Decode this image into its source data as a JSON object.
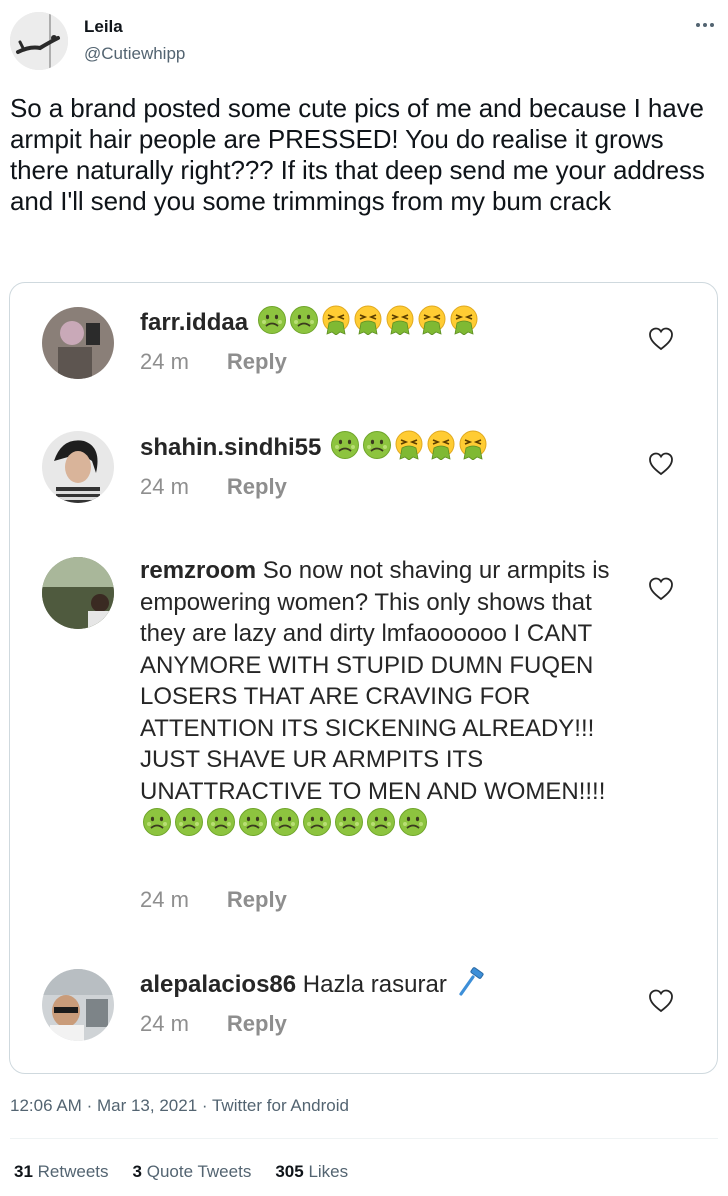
{
  "author": {
    "display_name": "Leila",
    "handle": "@Cutiewhipp"
  },
  "tweet": {
    "text": "So a brand posted some cute pics of me and because I have armpit hair people are PRESSED! You do realise it grows there naturally right??? If its that deep send me your address and I'll send you some trimmings from my bum crack"
  },
  "comments": [
    {
      "username": "farr.iddaa",
      "text": "",
      "emojis": [
        "nauseated-face",
        "nauseated-face",
        "vomiting-face",
        "vomiting-face",
        "vomiting-face",
        "vomiting-face",
        "vomiting-face"
      ],
      "time": "24 m",
      "reply_label": "Reply"
    },
    {
      "username": "shahin.sindhi55",
      "text": "",
      "emojis": [
        "nauseated-face",
        "nauseated-face",
        "vomiting-face",
        "vomiting-face",
        "vomiting-face"
      ],
      "time": "24 m",
      "reply_label": "Reply"
    },
    {
      "username": "remzroom",
      "text": "So now not shaving ur armpits is empowering women? This only shows that they are lazy and dirty lmfaoooooo I CANT ANYMORE WITH STUPID DUMN FUQEN LOSERS THAT ARE CRAVING FOR ATTENTION ITS SICKENING ALREADY!!! JUST SHAVE UR ARMPITS ITS UNATTRACTIVE TO MEN AND WOMEN!!!!",
      "emojis": [
        "nauseated-face",
        "nauseated-face",
        "nauseated-face",
        "nauseated-face",
        "nauseated-face",
        "nauseated-face",
        "nauseated-face",
        "nauseated-face",
        "nauseated-face"
      ],
      "time": "24 m",
      "reply_label": "Reply"
    },
    {
      "username": "alepalacios86",
      "text": "Hazla rasurar",
      "emojis": [
        "razor"
      ],
      "time": "24 m",
      "reply_label": "Reply"
    }
  ],
  "meta": {
    "time": "12:06 AM",
    "date": "Mar 13, 2021",
    "source": "Twitter for Android",
    "separator": "·"
  },
  "stats": {
    "retweets_count": "31",
    "retweets_label": "Retweets",
    "quotes_count": "3",
    "quotes_label": "Quote Tweets",
    "likes_count": "305",
    "likes_label": "Likes"
  },
  "colors": {
    "text_primary": "#0f1419",
    "text_secondary": "#536471",
    "ig_text": "#262626",
    "ig_meta": "#8e8e8e",
    "emoji_green": "#8dc43f",
    "emoji_yellow": "#ffcc33"
  }
}
